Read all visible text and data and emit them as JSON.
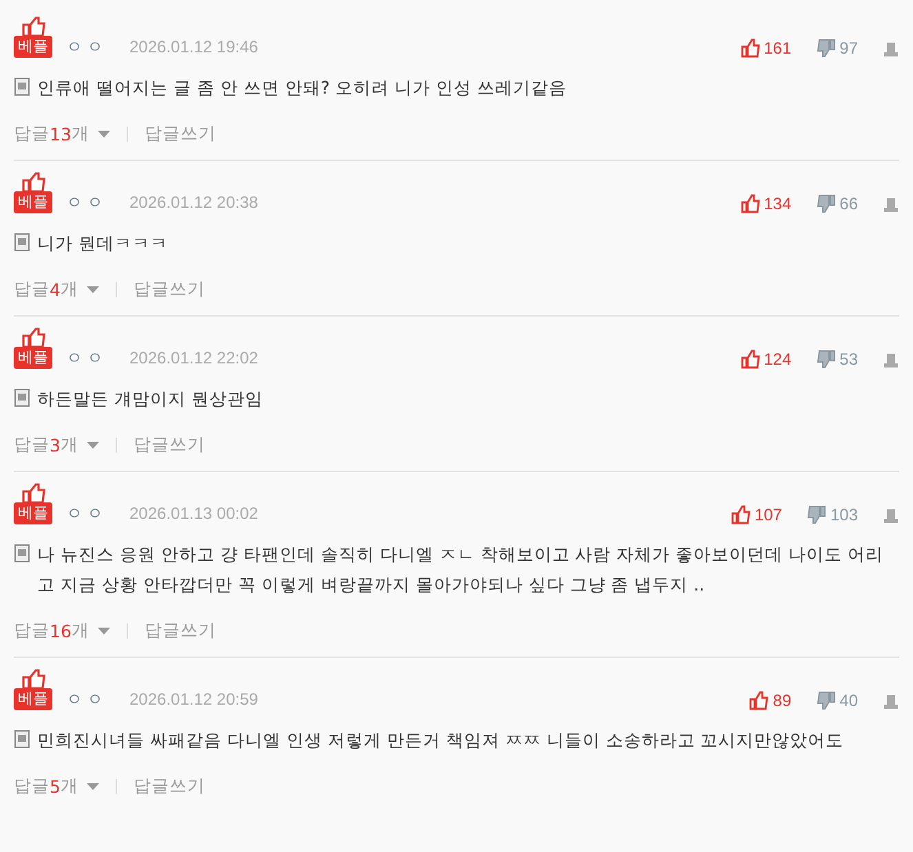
{
  "comments": [
    {
      "badge": "베플",
      "nickname": "ㅇㅇ",
      "date": "2026.01.12 19:46",
      "likes": "161",
      "dislikes": "97",
      "text": "인류애 떨어지는 글 좀 안 쓰면 안돼? 오히려 니가 인성 쓰레기같음",
      "reply_label": "답글",
      "reply_count": "13",
      "reply_unit": "개",
      "write_reply": "답글쓰기"
    },
    {
      "badge": "베플",
      "nickname": "ㅇㅇ",
      "date": "2026.01.12 20:38",
      "likes": "134",
      "dislikes": "66",
      "text": "니가 뭔데ㅋㅋㅋ",
      "reply_label": "답글",
      "reply_count": "4",
      "reply_unit": "개",
      "write_reply": "답글쓰기"
    },
    {
      "badge": "베플",
      "nickname": "ㅇㅇ",
      "date": "2026.01.12 22:02",
      "likes": "124",
      "dislikes": "53",
      "text": "하든말든 걔맘이지 뭔상관임",
      "reply_label": "답글",
      "reply_count": "3",
      "reply_unit": "개",
      "write_reply": "답글쓰기"
    },
    {
      "badge": "베플",
      "nickname": "ㅇㅇ",
      "date": "2026.01.13 00:02",
      "likes": "107",
      "dislikes": "103",
      "text": "나 뉴진스 응원 안하고 걍 타팬인데 솔직히 다니엘 ㅈㄴ 착해보이고 사람 자체가 좋아보이던데 나이도 어리고 지금 상황 안타깝더만 꼭 이렇게 벼랑끝까지 몰아가야되나 싶다 그냥 좀 냅두지 ..",
      "reply_label": "답글",
      "reply_count": "16",
      "reply_unit": "개",
      "write_reply": "답글쓰기"
    },
    {
      "badge": "베플",
      "nickname": "ㅇㅇ",
      "date": "2026.01.12 20:59",
      "likes": "89",
      "dislikes": "40",
      "text": "민희진시녀들 싸패같음 다니엘 인생 저렇게 만든거 책임져 ㅉㅉ 니들이 소송하라고 꼬시지만않았어도",
      "reply_label": "답글",
      "reply_count": "5",
      "reply_unit": "개",
      "write_reply": "답글쓰기"
    }
  ]
}
